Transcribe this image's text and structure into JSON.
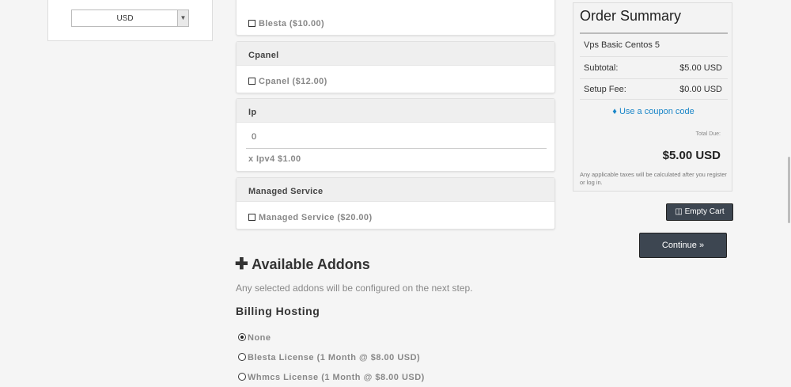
{
  "currency": {
    "selected": "USD",
    "arrow_icon": "chevron-down-icon"
  },
  "config_options": {
    "blesta": {
      "option_label": "Blesta ($10.00)",
      "checked": false
    },
    "cpanel": {
      "title": "Cpanel",
      "option_label": "Cpanel ($12.00)",
      "checked": false
    },
    "ip": {
      "title": "Ip",
      "quantity": "0",
      "unit_label": "x Ipv4 $1.00"
    },
    "managed_service": {
      "title": "Managed Service",
      "option_label": "Managed Service ($20.00)",
      "checked": false
    }
  },
  "addons": {
    "plus_icon": "plus-icon",
    "title": "Available Addons",
    "subtitle": "Any selected addons will be configured on the next step.",
    "billing_hosting": {
      "title": "Billing Hosting",
      "options": [
        {
          "label": "None",
          "selected": true
        },
        {
          "label": "Blesta License (1 Month @ $8.00 USD)",
          "selected": false
        },
        {
          "label": "Whmcs License (1 Month @ $8.00 USD)",
          "selected": false
        }
      ]
    }
  },
  "order_summary": {
    "title": "Order Summary",
    "product_name": "Vps Basic Centos 5",
    "subtotal_label": "Subtotal:",
    "subtotal_value": "$5.00 USD",
    "setup_fee_label": "Setup Fee:",
    "setup_fee_value": "$0.00 USD",
    "coupon_icon": "tag-icon",
    "coupon_link": "Use a coupon code",
    "total_due_label": "Total Due:",
    "total_due_value": "$5.00 USD",
    "tax_note": "Any applicable taxes will be calculated after you register or log in."
  },
  "actions": {
    "trash_icon": "trash-icon",
    "empty_cart": "Empty Cart",
    "continue": "Continue",
    "continue_icon": "double-chevron-right-icon"
  },
  "colors": {
    "accent_link": "#1a86c8",
    "button_dark": "#3d4651",
    "page_bg": "#f5f5f5"
  }
}
